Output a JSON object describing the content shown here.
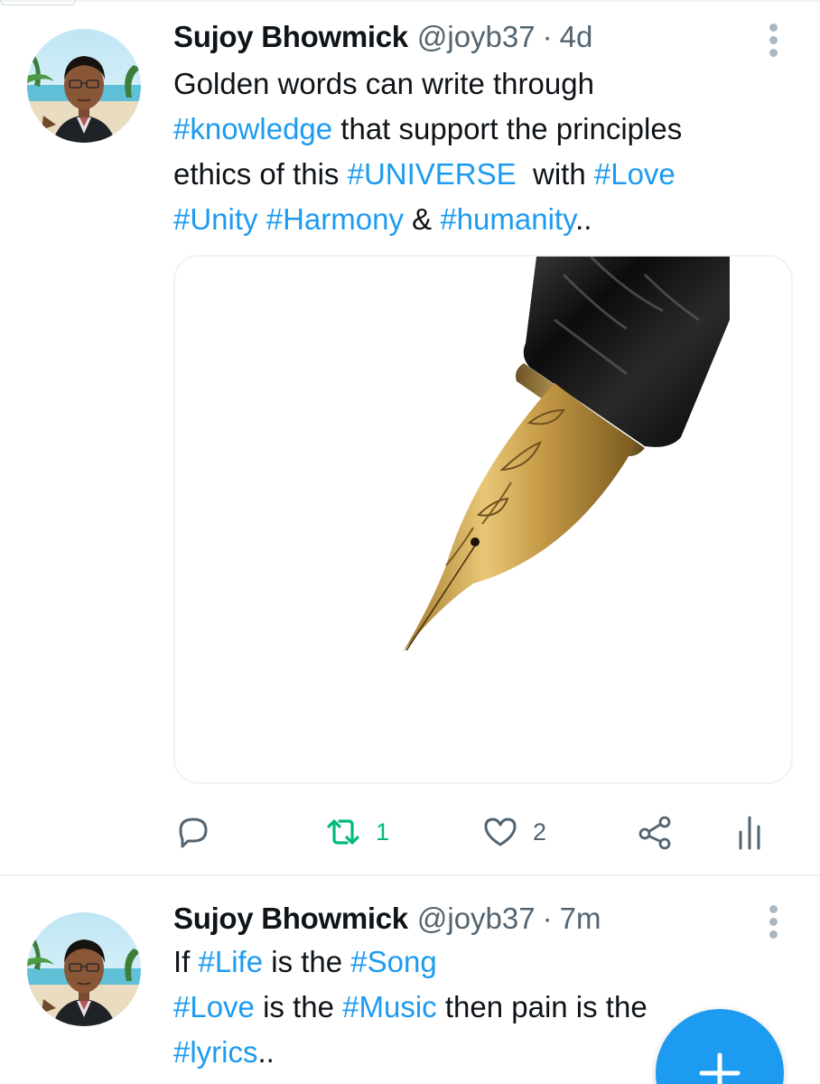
{
  "tweets": [
    {
      "display_name": "Sujoy Bhowmick",
      "handle": "@joyb37",
      "separator": "·",
      "time": "4d",
      "text_lines": [
        [
          {
            "t": "Golden words can write through",
            "tag": false
          }
        ],
        [
          {
            "t": "#knowledge",
            "tag": true
          },
          {
            "t": " that support the principles",
            "tag": false
          }
        ],
        [
          {
            "t": "ethics of this ",
            "tag": false
          },
          {
            "t": "#UNIVERSE",
            "tag": true
          },
          {
            "t": "  with ",
            "tag": false
          },
          {
            "t": "#Love",
            "tag": true
          }
        ],
        [
          {
            "t": "#Unity",
            "tag": true
          },
          {
            "t": " ",
            "tag": false
          },
          {
            "t": "#Harmony",
            "tag": true
          },
          {
            "t": " & ",
            "tag": false
          },
          {
            "t": "#humanity",
            "tag": true
          },
          {
            "t": "..",
            "tag": false
          }
        ]
      ],
      "media": {
        "icon": "fountain-pen-nib"
      },
      "actions": {
        "reply_icon": "reply-icon",
        "retweet_icon": "retweet-icon",
        "retweet_count": "1",
        "like_icon": "heart-icon",
        "like_count": "2",
        "share_icon": "share-icon",
        "analytics_icon": "analytics-icon",
        "retweet_color": "#00ba7c"
      }
    },
    {
      "display_name": "Sujoy Bhowmick",
      "handle": "@joyb37",
      "separator": "·",
      "time": "7m",
      "text_lines": [
        [
          {
            "t": "If ",
            "tag": false
          },
          {
            "t": "#Life",
            "tag": true
          },
          {
            "t": " is the ",
            "tag": false
          },
          {
            "t": "#Song",
            "tag": true
          }
        ],
        [
          {
            "t": "#Love",
            "tag": true
          },
          {
            "t": " is the ",
            "tag": false
          },
          {
            "t": "#Music",
            "tag": true
          },
          {
            "t": " then pain is the",
            "tag": false
          }
        ],
        [
          {
            "t": "#lyrics",
            "tag": true
          },
          {
            "t": "..",
            "tag": false
          }
        ]
      ]
    }
  ],
  "fab": {
    "icon": "plus-icon",
    "color": "#1d9bf0"
  },
  "colors": {
    "link": "#1d9bf0",
    "text": "#0f1419",
    "muted": "#536471",
    "divider": "#eff3f4"
  }
}
